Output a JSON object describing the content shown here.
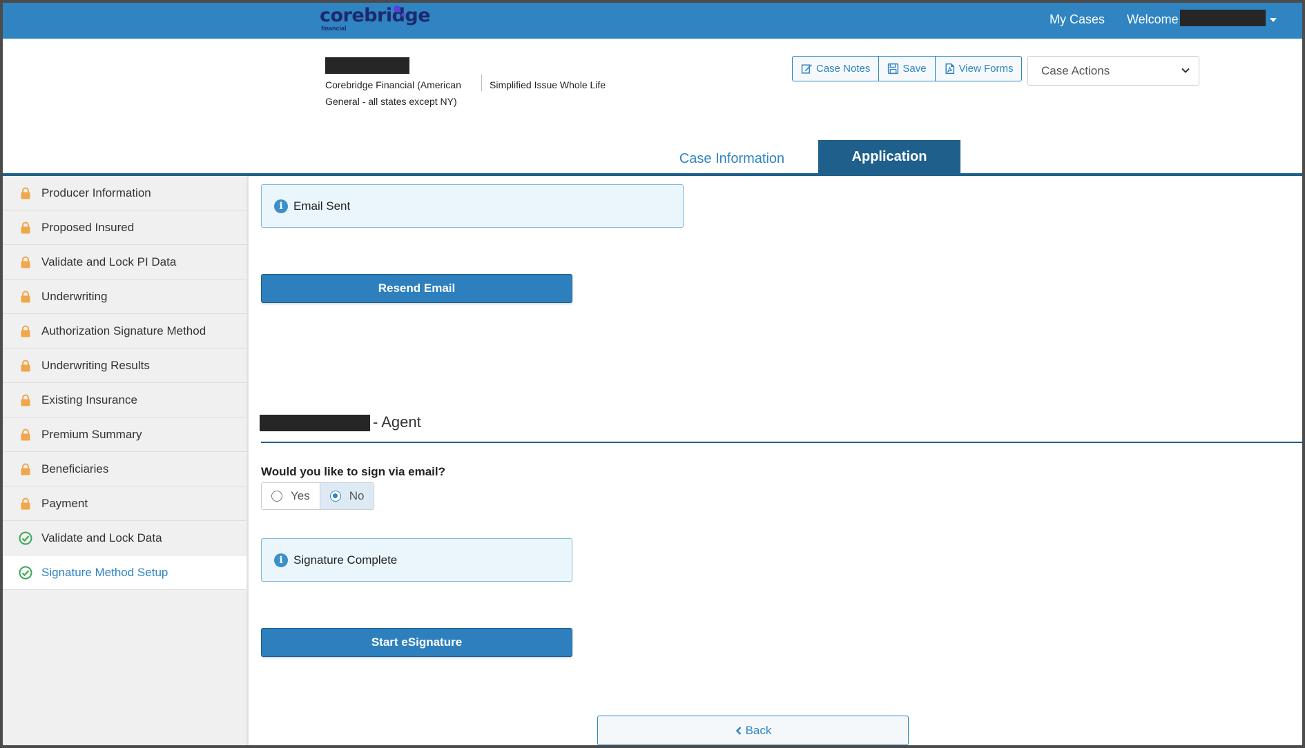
{
  "header": {
    "logo_text": "corebridge",
    "logo_sub": "financial",
    "nav_my_cases": "My Cases",
    "nav_welcome": "Welcome"
  },
  "case": {
    "carrier": "Corebridge Financial (American General - all states except NY)",
    "product": "Simplified Issue Whole Life"
  },
  "toolbar": {
    "case_notes": "Case Notes",
    "save": "Save",
    "view_forms": "View Forms",
    "case_actions": "Case Actions"
  },
  "tabs": {
    "case_information": "Case Information",
    "application": "Application"
  },
  "sidebar": {
    "items": [
      {
        "label": "Producer Information",
        "status": "locked"
      },
      {
        "label": "Proposed Insured",
        "status": "locked"
      },
      {
        "label": "Validate and Lock PI Data",
        "status": "locked"
      },
      {
        "label": "Underwriting",
        "status": "locked"
      },
      {
        "label": "Authorization Signature Method",
        "status": "locked"
      },
      {
        "label": "Underwriting Results",
        "status": "locked"
      },
      {
        "label": "Existing Insurance",
        "status": "locked"
      },
      {
        "label": "Premium Summary",
        "status": "locked"
      },
      {
        "label": "Beneficiaries",
        "status": "locked"
      },
      {
        "label": "Payment",
        "status": "locked"
      },
      {
        "label": "Validate and Lock Data",
        "status": "complete"
      },
      {
        "label": "Signature Method Setup",
        "status": "complete"
      }
    ]
  },
  "main": {
    "email_alert": "Email Sent",
    "resend_button": "Resend Email",
    "agent_suffix": "- Agent",
    "question": "Would you like to sign via email?",
    "radio_yes": "Yes",
    "radio_no": "No",
    "selected": "No",
    "signature_alert": "Signature Complete",
    "esign_button": "Start eSignature",
    "back_button": "Back"
  },
  "colors": {
    "brand_blue": "#2f84c1",
    "dark_blue": "#1f5f8b",
    "lock_orange": "#f0a64a",
    "check_green": "#3aa757"
  }
}
